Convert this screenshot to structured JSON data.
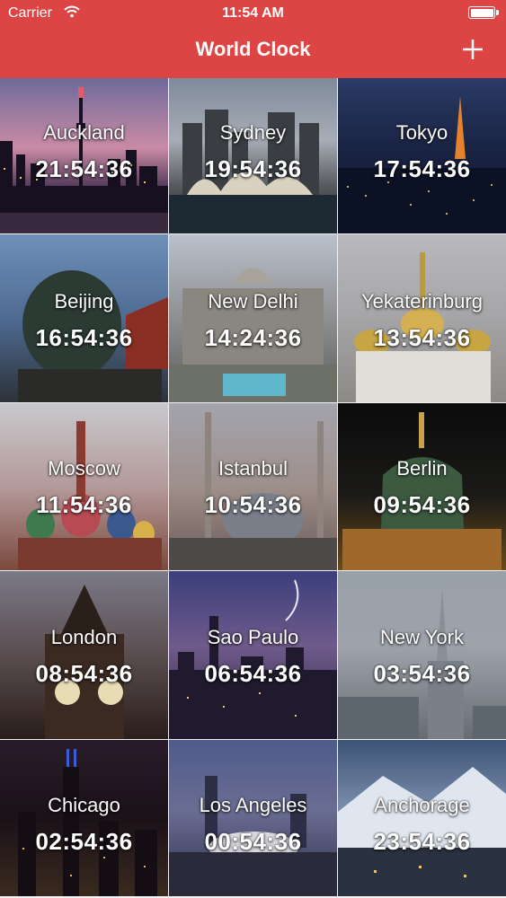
{
  "status_bar": {
    "carrier": "Carrier",
    "time": "11:54 AM"
  },
  "nav": {
    "title": "World Clock",
    "add_icon": "plus-icon"
  },
  "colors": {
    "nav_background": "#dc4544",
    "text": "#ffffff"
  },
  "cities": [
    {
      "name": "Auckland",
      "time": "21:54:36"
    },
    {
      "name": "Sydney",
      "time": "19:54:36"
    },
    {
      "name": "Tokyo",
      "time": "17:54:36"
    },
    {
      "name": "Beijing",
      "time": "16:54:36"
    },
    {
      "name": "New Delhi",
      "time": "14:24:36"
    },
    {
      "name": "Yekaterinburg",
      "time": "13:54:36"
    },
    {
      "name": "Moscow",
      "time": "11:54:36"
    },
    {
      "name": "Istanbul",
      "time": "10:54:36"
    },
    {
      "name": "Berlin",
      "time": "09:54:36"
    },
    {
      "name": "London",
      "time": "08:54:36"
    },
    {
      "name": "Sao Paulo",
      "time": "06:54:36"
    },
    {
      "name": "New York",
      "time": "03:54:36"
    },
    {
      "name": "Chicago",
      "time": "02:54:36"
    },
    {
      "name": "Los Angeles",
      "time": "00:54:36"
    },
    {
      "name": "Anchorage",
      "time": "23:54:36"
    }
  ]
}
